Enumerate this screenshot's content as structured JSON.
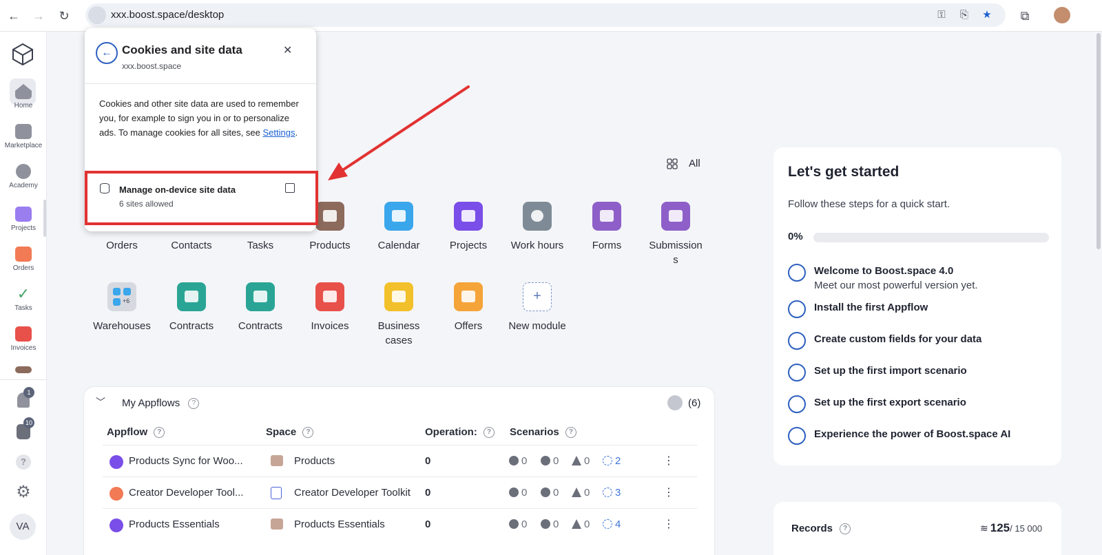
{
  "browser": {
    "url": "xxx.boost.space/desktop",
    "icons": [
      "back-icon",
      "forward-icon",
      "reload-icon",
      "site-settings-icon",
      "password-key-icon",
      "install-app-icon",
      "bookmark-star-icon",
      "extensions-icon"
    ]
  },
  "sidebar": {
    "items": [
      {
        "label": "Home",
        "icon": "home-icon"
      },
      {
        "label": "Marketplace",
        "icon": "store-icon"
      },
      {
        "label": "Academy",
        "icon": "play-icon"
      },
      {
        "label": "Projects",
        "icon": "folder-icon"
      },
      {
        "label": "Orders",
        "icon": "orders-icon"
      },
      {
        "label": "Tasks",
        "icon": "checkmark-icon"
      },
      {
        "label": "Invoices",
        "icon": "invoice-icon"
      }
    ],
    "notifications_count": "1",
    "announcements_count": "10",
    "help_mark": "?",
    "avatar_initials": "VA"
  },
  "modules": {
    "all_label": "All",
    "row1": [
      {
        "label": "Orders",
        "color": "#f06a3c"
      },
      {
        "label": "Contacts",
        "color": "#4a63d8"
      },
      {
        "label": "Tasks",
        "color": "#46a46a"
      },
      {
        "label": "Products",
        "color": "#8c6a5c"
      },
      {
        "label": "Calendar",
        "color": "#3aa6ec"
      },
      {
        "label": "Projects",
        "color": "#7a4ee8"
      },
      {
        "label": "Work hours",
        "color": "#7e8b97"
      },
      {
        "label": "Forms",
        "color": "#8e5fc8"
      },
      {
        "label": "Submission\ns",
        "color": "#8e5fc8"
      }
    ],
    "row2": [
      {
        "label": "Warehouses",
        "color": "#d6d9e0"
      },
      {
        "label": "Contracts",
        "color": "#2aa595"
      },
      {
        "label": "Contracts",
        "color": "#2aa595"
      },
      {
        "label": "Invoices",
        "color": "#e8504a"
      },
      {
        "label": "Business\ncases",
        "color": "#f2c02a"
      },
      {
        "label": "Offers",
        "color": "#f5a43a"
      },
      {
        "label": "New module",
        "color": "#ffffff"
      }
    ]
  },
  "appflows": {
    "title": "My Appflows",
    "count": "(6)",
    "columns": [
      "Appflow",
      "Space",
      "Operation:",
      "Scenarios"
    ],
    "rows": [
      {
        "appflow": "Products Sync for Woo...",
        "space": "Products",
        "operations": "0",
        "running": "0",
        "paused": "0",
        "warnings": "0",
        "scenarios": "2"
      },
      {
        "appflow": "Creator Developer Tool...",
        "space": "Creator Developer Toolkit",
        "operations": "0",
        "running": "0",
        "paused": "0",
        "warnings": "0",
        "scenarios": "3"
      },
      {
        "appflow": "Products Essentials",
        "space": "Products Essentials",
        "operations": "0",
        "running": "0",
        "paused": "0",
        "warnings": "0",
        "scenarios": "4"
      }
    ]
  },
  "started": {
    "title": "Let's get started",
    "subtitle": "Follow these steps for a quick start.",
    "progress_label": "0%",
    "progress": 0,
    "steps": [
      {
        "text": "Welcome to Boost.space 4.0",
        "note": "Meet our most powerful version yet."
      },
      {
        "text": "Install the first Appflow",
        "note": ""
      },
      {
        "text": "Create custom fields for your data",
        "note": ""
      },
      {
        "text": "Set up the first import scenario",
        "note": ""
      },
      {
        "text": "Set up the first export scenario",
        "note": ""
      },
      {
        "text": "Experience the power of Boost.space AI",
        "note": ""
      }
    ]
  },
  "records": {
    "label": "Records",
    "value": "125",
    "max": "/ 15 000"
  },
  "popup": {
    "title": "Cookies and site data",
    "domain": "xxx.boost.space",
    "body_text": "Cookies and other site data are used to remember you, for example to sign you in or to personalize ads. To manage cookies for all sites, see",
    "settings_link": "Settings",
    "body_end": ".",
    "manage_title": "Manage on-device site data",
    "manage_sub": "6 sites allowed"
  },
  "colors": {
    "accent": "#2c5fbf",
    "highlight": "#e23232",
    "link": "#1a5fd0"
  }
}
